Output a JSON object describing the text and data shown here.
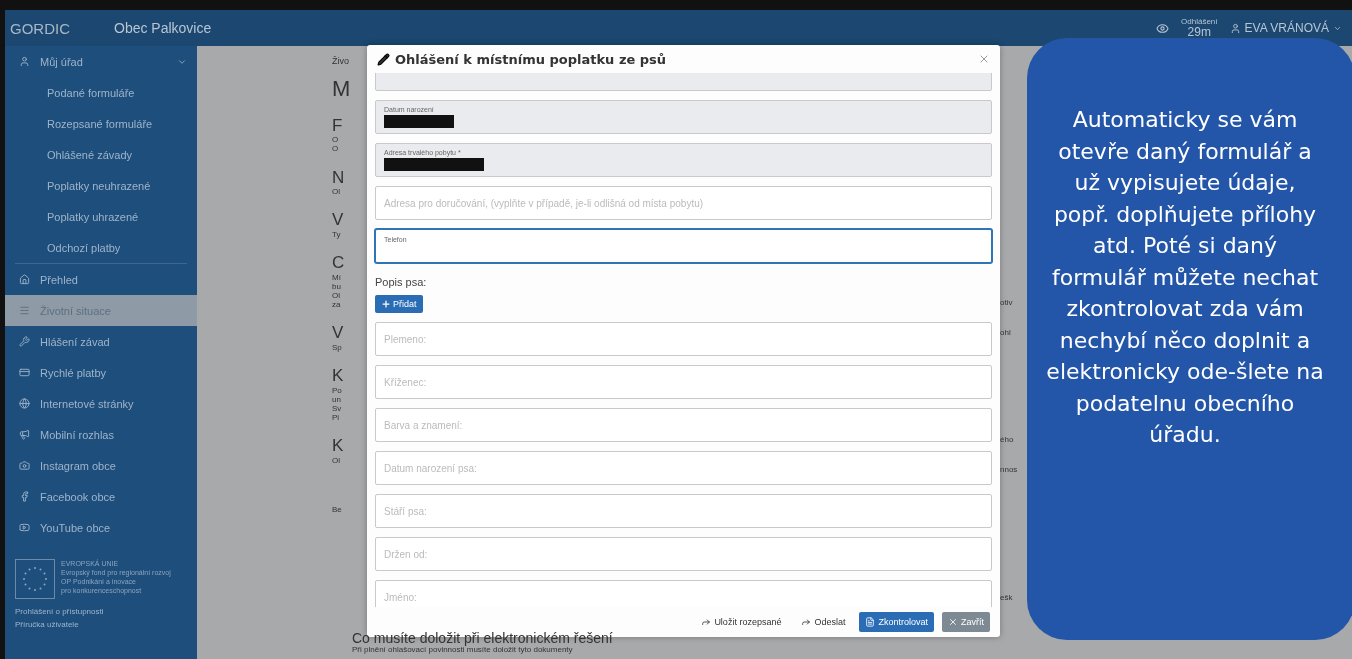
{
  "header": {
    "logo": "GORDIC",
    "municipality": "Obec Palkovice",
    "session_label": "Odhlášení",
    "session_time": "29m",
    "user": "EVA VRÁNOVÁ"
  },
  "sidebar": {
    "items": [
      {
        "label": "Můj úřad",
        "selected": false,
        "expanded": true,
        "children": [
          {
            "label": "Podané formuláře",
            "selected": false
          },
          {
            "label": "Rozepsané formuláře",
            "selected": false
          },
          {
            "label": "Ohlášené závady",
            "selected": false
          },
          {
            "label": "Poplatky neuhrazené",
            "selected": false
          },
          {
            "label": "Poplatky uhrazené",
            "selected": false
          },
          {
            "label": "Odchozí platby",
            "selected": false
          }
        ]
      },
      {
        "label": "Přehled",
        "selected": false
      },
      {
        "label": "Životní situace",
        "selected": true
      },
      {
        "label": "Hlášení závad",
        "selected": false
      },
      {
        "label": "Rychlé platby",
        "selected": false
      },
      {
        "label": "Internetové stránky",
        "selected": false
      },
      {
        "label": "Mobilní rozhlas",
        "selected": false
      },
      {
        "label": "Instagram obce",
        "selected": false
      },
      {
        "label": "Facebook obce",
        "selected": false
      },
      {
        "label": "YouTube obce",
        "selected": false
      }
    ],
    "eu_logo": {
      "lines": [
        "EVROPSKÁ UNIE",
        "Evropský fond pro regionální rozvoj",
        "OP Podnikání a inovace",
        "pro konkurenceschopnost"
      ]
    },
    "links": [
      "Prohlášení o přístupnosti",
      "Příručka uživatele"
    ]
  },
  "background": {
    "left_fragments": [
      {
        "kind": "crumb",
        "text": "Živo"
      },
      {
        "kind": "title",
        "text": "M"
      },
      {
        "kind": "heading",
        "text": "F"
      },
      {
        "kind": "text",
        "text": "O"
      },
      {
        "kind": "text",
        "text": "O"
      },
      {
        "kind": "heading",
        "text": "N"
      },
      {
        "kind": "text",
        "text": "Ol"
      },
      {
        "kind": "heading",
        "text": "V"
      },
      {
        "kind": "text",
        "text": "Ty"
      },
      {
        "kind": "heading",
        "text": "C"
      },
      {
        "kind": "text",
        "text": "Mí"
      },
      {
        "kind": "text",
        "text": "bu"
      },
      {
        "kind": "text",
        "text": "Ol"
      },
      {
        "kind": "text",
        "text": "za"
      },
      {
        "kind": "heading",
        "text": "V"
      },
      {
        "kind": "text",
        "text": "Sp"
      },
      {
        "kind": "heading",
        "text": "K"
      },
      {
        "kind": "text",
        "text": "Po"
      },
      {
        "kind": "text",
        "text": "un"
      },
      {
        "kind": "text",
        "text": "Sv"
      },
      {
        "kind": "text",
        "text": "Pi"
      },
      {
        "kind": "heading",
        "text": "K"
      },
      {
        "kind": "text",
        "text": "Ol"
      },
      {
        "kind": "gap"
      },
      {
        "kind": "text",
        "text": "Be"
      }
    ],
    "right_fragments": [
      "otiv",
      "ohl",
      "ého",
      "nnos",
      "ešk"
    ],
    "bottom_heading": "Co musíte doložit při elektronickém řešení",
    "bottom_text": "Při plnění ohlašovací povinnosti musíte doložit tyto dokumenty"
  },
  "modal": {
    "title": "Ohlášení k místnímu poplatku ze psů",
    "fields": [
      {
        "kind": "floating",
        "disabled": true,
        "focused": false
      },
      {
        "kind": "floating",
        "label": "Datum narození",
        "disabled": true,
        "redacted": true,
        "focused": false
      },
      {
        "kind": "floating",
        "label": "Adresa trvalého pobytu *",
        "disabled": true,
        "redacted": true,
        "focused": false
      },
      {
        "kind": "placeholder",
        "placeholder": "Adresa pro doručování, (vyplňte v případě, je-li odlišná od místa pobytu)",
        "disabled": false,
        "focused": false
      },
      {
        "kind": "floating",
        "label": "Telefon",
        "disabled": false,
        "focused": true
      }
    ],
    "section_label": "Popis psa:",
    "add_button": "Přidat",
    "dog_fields": [
      {
        "placeholder": "Plemeno:"
      },
      {
        "placeholder": "Kříženec:"
      },
      {
        "placeholder": "Barva a znamení:"
      },
      {
        "placeholder": "Datum narození psa:"
      },
      {
        "placeholder": "Stáří psa:"
      },
      {
        "placeholder": "Držen od:"
      },
      {
        "placeholder": "Jméno:"
      }
    ],
    "buttons": [
      {
        "kind": "link",
        "label": "Uložit rozepsané"
      },
      {
        "kind": "link",
        "label": "Odeslat"
      },
      {
        "kind": "primary",
        "label": "Zkontrolovat"
      },
      {
        "kind": "secondary",
        "label": "Zavřít"
      }
    ]
  },
  "callout": {
    "text": "Automaticky se vám otevře daný formulář a už vypisujete údaje, popř. doplňujete přílohy atd. Poté si daný formulář můžete nechat zkontrolovat zda vám nechybí něco doplnit a elektronicky ode-šlete na podatelnu obecního úřadu."
  }
}
